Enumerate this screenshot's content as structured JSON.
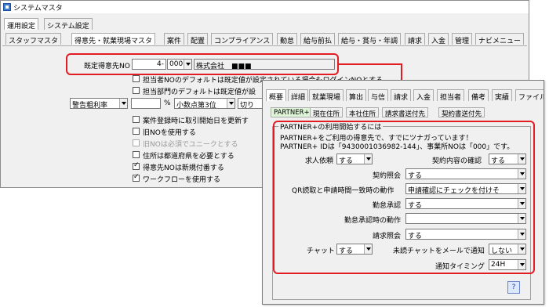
{
  "window": {
    "title": "システムマスタ"
  },
  "top_tabs": [
    "運用設定",
    "システム設定"
  ],
  "sub_tabs": [
    "スタッフマスタ",
    "得意先・就業現場マスタ",
    "案件",
    "配置",
    "コンプライアンス",
    "勤怠",
    "給与前払",
    "給与・賞与・年調",
    "請求",
    "入金",
    "管理",
    "ナビメニュー"
  ],
  "main": {
    "default_customer_label": "既定得意先NO",
    "customer_no": "4",
    "customer_sep": "-",
    "customer_branch": "000",
    "customer_name": "株式会社　■■■",
    "staff_default_label": "担当者NOのデフォルトは既定値が設定されている場合もログインNOとする",
    "dept_default_label": "担当部門のデフォルトは既定値が設",
    "profit_combo": "警告粗利率",
    "percent_unit": "%",
    "decimal_combo": "小数点第3位",
    "round_combo": "切り",
    "options": [
      {
        "label": "案件登録時に取引開始日を更新す",
        "checked": false,
        "disabled": false
      },
      {
        "label": "旧NOを使用する",
        "checked": false,
        "disabled": false
      },
      {
        "label": "旧NOは必須でユニークとする",
        "checked": false,
        "disabled": true
      },
      {
        "label": "住所は都道府県を必要とする",
        "checked": false,
        "disabled": false
      },
      {
        "label": "得意先NOは新規付番する",
        "checked": true,
        "disabled": false
      },
      {
        "label": "ワークフローを使用する",
        "checked": true,
        "disabled": false
      }
    ]
  },
  "panel": {
    "tabs": [
      "概要",
      "詳細",
      "就業現場",
      "算出",
      "与信",
      "請求",
      "入金",
      "担当者",
      "備考",
      "実績",
      "ファイル"
    ],
    "subtabs": [
      "PARTNER+",
      "現在住所",
      "本社住所",
      "請求書送付先",
      "契約書送付先"
    ],
    "group_title": "PARTNER+の利用開始するには",
    "intro_line1": "PARTNER+をご利用の得意先で、すでにツナガっています！",
    "intro_line2": "PARTNER+ IDは「9430001036982-144」、事業所NOは「000」です。",
    "fields": {
      "job_request_label": "求人依頼",
      "job_request_value": "する",
      "contract_confirm_label": "契約内容の確認",
      "contract_confirm_value": "する",
      "contract_query_label": "契約照会",
      "contract_query_value": "する",
      "qr_label": "QR読取と申請時間一致時の動作",
      "qr_value": "申請確認にチェックを付けそ",
      "attendance_approval_label": "勤怠承認",
      "attendance_approval_value": "する",
      "attendance_approval_action_label": "勤怠承認時の動作",
      "attendance_approval_action_value": "",
      "billing_query_label": "請求照会",
      "billing_query_value": "する",
      "chat_label": "チャット",
      "chat_value": "する",
      "unread_chat_label": "未読チャットをメールで通知",
      "unread_chat_value": "しない",
      "notify_timing_label": "通知タイミング",
      "notify_timing_value": "24H"
    },
    "help_label": "?"
  },
  "colors": {
    "highlight": "#e31b23",
    "active_subtab": "#dff5d8"
  }
}
